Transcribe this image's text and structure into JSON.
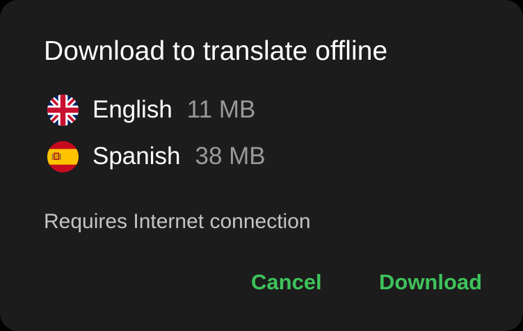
{
  "dialog": {
    "title": "Download to translate offline",
    "languages": [
      {
        "name": "English",
        "size": "11 MB",
        "flag_icon": "uk-flag-icon"
      },
      {
        "name": "Spanish",
        "size": "38 MB",
        "flag_icon": "spain-flag-icon"
      }
    ],
    "note": "Requires Internet connection",
    "cancel_label": "Cancel",
    "download_label": "Download"
  },
  "colors": {
    "background": "#1c1c1c",
    "accent": "#3ec35a",
    "text_primary": "#ffffff",
    "text_secondary": "#9a9a9a"
  }
}
